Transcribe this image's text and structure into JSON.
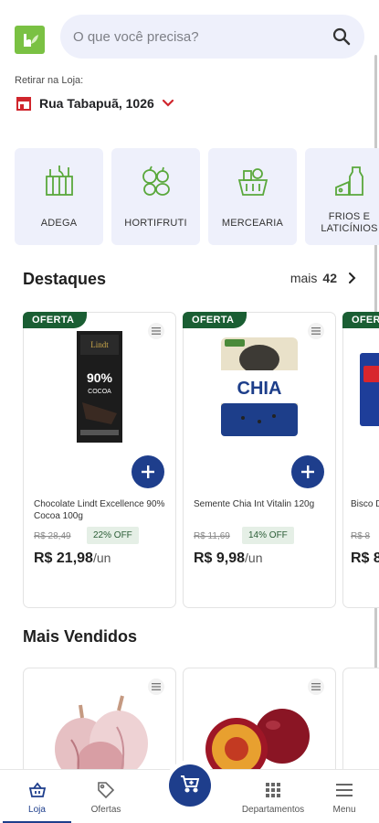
{
  "header": {
    "search_placeholder": "O que você precisa?",
    "pickup_label": "Retirar na Loja:",
    "store_name": "Rua Tabapuã, 1026"
  },
  "categories": [
    {
      "label": "ADEGA",
      "icon": "wine-icon"
    },
    {
      "label": "HORTIFRUTI",
      "icon": "fruits-icon"
    },
    {
      "label": "MERCEARIA",
      "icon": "basket-icon"
    },
    {
      "label": "FRIOS E LATICÍNIOS",
      "icon": "dairy-icon"
    }
  ],
  "highlights": {
    "title": "Destaques",
    "more_label": "mais",
    "more_count": "42",
    "products": [
      {
        "badge": "OFERTA",
        "name": "Chocolate Lindt Excellence 90% Cocoa 100g",
        "old_price": "R$ 28,49",
        "discount": "22% OFF",
        "price": "R$ 21,98",
        "unit": "/un"
      },
      {
        "badge": "OFERTA",
        "name": "Semente Chia Int Vitalin 120g",
        "old_price": "R$ 11,69",
        "discount": "14% OFF",
        "price": "R$ 9,98",
        "unit": "/un"
      },
      {
        "badge": "OFER",
        "name": "Bisco Diges",
        "old_price": "R$ 8",
        "price": "R$ 8"
      }
    ]
  },
  "best_sellers": {
    "title": "Mais Vendidos"
  },
  "nav": {
    "items": [
      {
        "label": "Loja",
        "icon": "basket-icon"
      },
      {
        "label": "Ofertas",
        "icon": "tag-icon"
      },
      {
        "label": "Departamentos",
        "icon": "grid-icon"
      },
      {
        "label": "Menu",
        "icon": "menu-icon"
      }
    ],
    "cart_icon": "cart-icon"
  },
  "colors": {
    "primary": "#1e3e8c",
    "offer_green": "#1a5e33",
    "category_bg": "#eef0fb",
    "brand_green": "#7ac143"
  }
}
